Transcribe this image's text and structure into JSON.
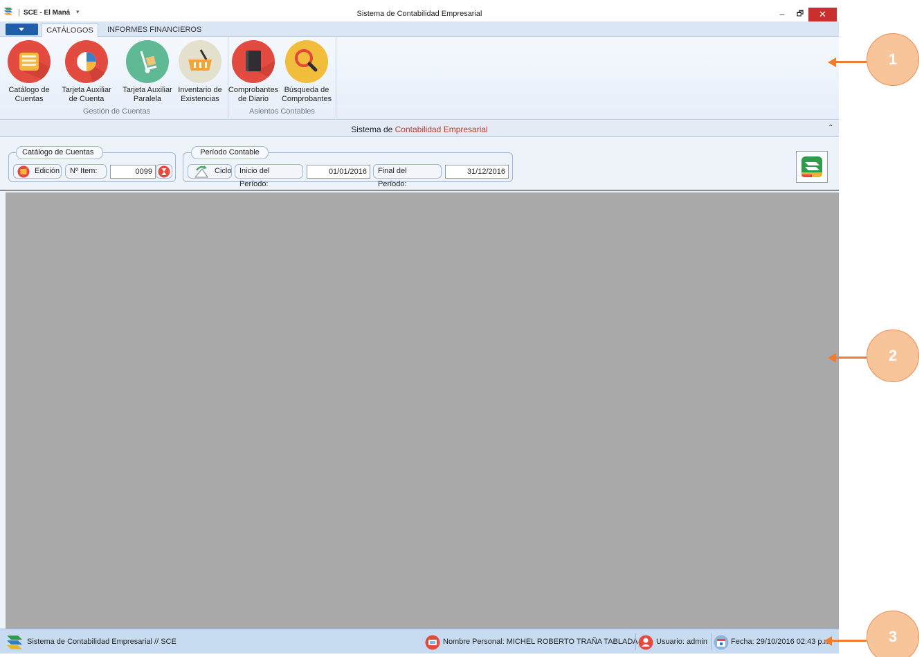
{
  "window": {
    "app_name": "SCE - El Maná",
    "title": "Sistema de Contabilidad Empresarial",
    "min_glyph": "–",
    "max_glyph": "🗗",
    "close_glyph": "✕"
  },
  "ribbon_tabs": [
    "CATÁLOGOS",
    "INFORMES FINANCIEROS"
  ],
  "ribbon_groups": [
    {
      "label": "Gestión de Cuentas",
      "buttons": [
        {
          "label": "Catálogo de Cuentas",
          "icon": "account-catalog-icon"
        },
        {
          "label": "Tarjeta Auxiliar de Cuenta",
          "icon": "pie-chart-icon"
        },
        {
          "label": "Tarjeta Auxiliar Paralela",
          "icon": "hand-truck-icon"
        },
        {
          "label": "Inventario de Existencias",
          "icon": "basket-icon"
        }
      ]
    },
    {
      "label": "Asientos Contables",
      "buttons": [
        {
          "label": "Comprobantes de Diario",
          "icon": "journal-book-icon"
        },
        {
          "label": "Búsqueda de Comprobantes",
          "icon": "magnifier-icon"
        }
      ]
    }
  ],
  "subheader": {
    "title_prefix": "Sistema de ",
    "title_highlight": "Contabilidad Empresarial",
    "collapse_glyph": "⌃"
  },
  "catalog_group": {
    "title": "Catálogo de Cuentas",
    "edit_label": "Edición",
    "item_label": "Nº Item:",
    "item_value": "0099"
  },
  "period_group": {
    "title": "Período Contable",
    "cycle_label": "Ciclo",
    "start_label": "Inicio del Período:",
    "start_value": "01/01/2016",
    "end_label": "Final del Período:",
    "end_value": "31/12/2016"
  },
  "status": {
    "left": "Sistema de Contabilidad Empresarial // SCE",
    "name": "Nombre Personal: MICHEL ROBERTO TRAÑA TABLADA",
    "user": "Usuario: admin",
    "date": "Fecha: 29/10/2016 02:43 p.m."
  },
  "callouts": [
    "1",
    "2",
    "3"
  ],
  "colors": {
    "accent_red": "#c0392b",
    "ribbon_blue": "#1f5fa8",
    "callout_fill": "#f8c49a",
    "callout_arrow": "#ee7d31"
  }
}
